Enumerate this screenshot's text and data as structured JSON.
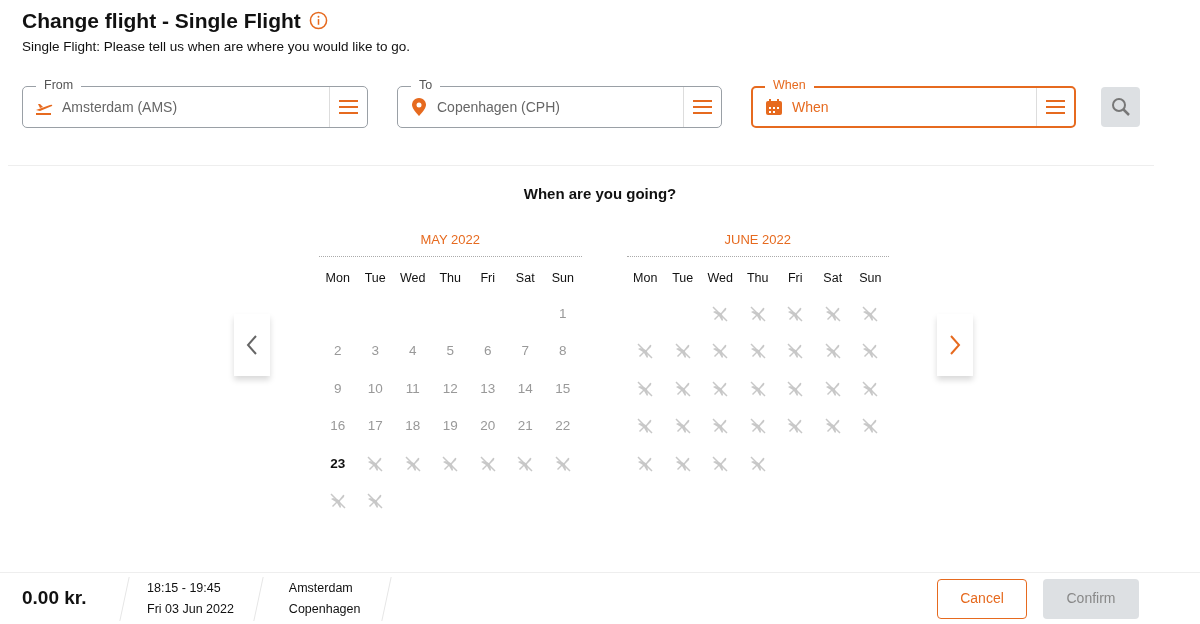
{
  "header": {
    "title": "Change flight - Single Flight",
    "subtitle": "Single Flight: Please tell us when are where you would like to go."
  },
  "fields": [
    {
      "kind": "departure",
      "label": "From",
      "value": "Amsterdam (AMS)",
      "active": false
    },
    {
      "kind": "location",
      "label": "To",
      "value": "Copenhagen (CPH)",
      "active": false
    },
    {
      "kind": "date",
      "label": "When",
      "value": "When",
      "active": true
    }
  ],
  "calendar": {
    "heading": "When are you going?",
    "months": [
      {
        "title": "MAY 2022",
        "weekdays": [
          "Mon",
          "Tue",
          "Wed",
          "Thu",
          "Fri",
          "Sat",
          "Sun"
        ],
        "days": [
          {
            "kind": "blank"
          },
          {
            "kind": "blank"
          },
          {
            "kind": "blank"
          },
          {
            "kind": "blank"
          },
          {
            "kind": "blank"
          },
          {
            "kind": "blank"
          },
          {
            "kind": "past",
            "day": "1"
          },
          {
            "kind": "past",
            "day": "2"
          },
          {
            "kind": "past",
            "day": "3"
          },
          {
            "kind": "past",
            "day": "4"
          },
          {
            "kind": "past",
            "day": "5"
          },
          {
            "kind": "past",
            "day": "6"
          },
          {
            "kind": "past",
            "day": "7"
          },
          {
            "kind": "past",
            "day": "8"
          },
          {
            "kind": "past",
            "day": "9"
          },
          {
            "kind": "past",
            "day": "10"
          },
          {
            "kind": "past",
            "day": "11"
          },
          {
            "kind": "past",
            "day": "12"
          },
          {
            "kind": "past",
            "day": "13"
          },
          {
            "kind": "past",
            "day": "14"
          },
          {
            "kind": "past",
            "day": "15"
          },
          {
            "kind": "past",
            "day": "16"
          },
          {
            "kind": "past",
            "day": "17"
          },
          {
            "kind": "past",
            "day": "18"
          },
          {
            "kind": "past",
            "day": "19"
          },
          {
            "kind": "past",
            "day": "20"
          },
          {
            "kind": "past",
            "day": "21"
          },
          {
            "kind": "past",
            "day": "22"
          },
          {
            "kind": "today",
            "day": "23"
          },
          {
            "kind": "no_flight"
          },
          {
            "kind": "no_flight"
          },
          {
            "kind": "no_flight"
          },
          {
            "kind": "no_flight"
          },
          {
            "kind": "no_flight"
          },
          {
            "kind": "no_flight"
          },
          {
            "kind": "no_flight"
          },
          {
            "kind": "no_flight"
          }
        ]
      },
      {
        "title": "JUNE 2022",
        "weekdays": [
          "Mon",
          "Tue",
          "Wed",
          "Thu",
          "Fri",
          "Sat",
          "Sun"
        ],
        "days": [
          {
            "kind": "blank"
          },
          {
            "kind": "blank"
          },
          {
            "kind": "no_flight"
          },
          {
            "kind": "no_flight"
          },
          {
            "kind": "no_flight"
          },
          {
            "kind": "no_flight"
          },
          {
            "kind": "no_flight"
          },
          {
            "kind": "no_flight"
          },
          {
            "kind": "no_flight"
          },
          {
            "kind": "no_flight"
          },
          {
            "kind": "no_flight"
          },
          {
            "kind": "no_flight"
          },
          {
            "kind": "no_flight"
          },
          {
            "kind": "no_flight"
          },
          {
            "kind": "no_flight"
          },
          {
            "kind": "no_flight"
          },
          {
            "kind": "no_flight"
          },
          {
            "kind": "no_flight"
          },
          {
            "kind": "no_flight"
          },
          {
            "kind": "no_flight"
          },
          {
            "kind": "no_flight"
          },
          {
            "kind": "no_flight"
          },
          {
            "kind": "no_flight"
          },
          {
            "kind": "no_flight"
          },
          {
            "kind": "no_flight"
          },
          {
            "kind": "no_flight"
          },
          {
            "kind": "no_flight"
          },
          {
            "kind": "no_flight"
          },
          {
            "kind": "no_flight"
          },
          {
            "kind": "no_flight"
          },
          {
            "kind": "no_flight"
          },
          {
            "kind": "no_flight"
          }
        ]
      }
    ]
  },
  "footer": {
    "price": "0.00 kr.",
    "time": "18:15 - 19:45",
    "date": "Fri 03 Jun 2022",
    "origin": "Amsterdam",
    "destination": "Copenhagen",
    "buttons": [
      {
        "kind": "secondary",
        "label": "Cancel",
        "disabled": false
      },
      {
        "kind": "primary",
        "label": "Confirm",
        "disabled": true
      }
    ]
  }
}
